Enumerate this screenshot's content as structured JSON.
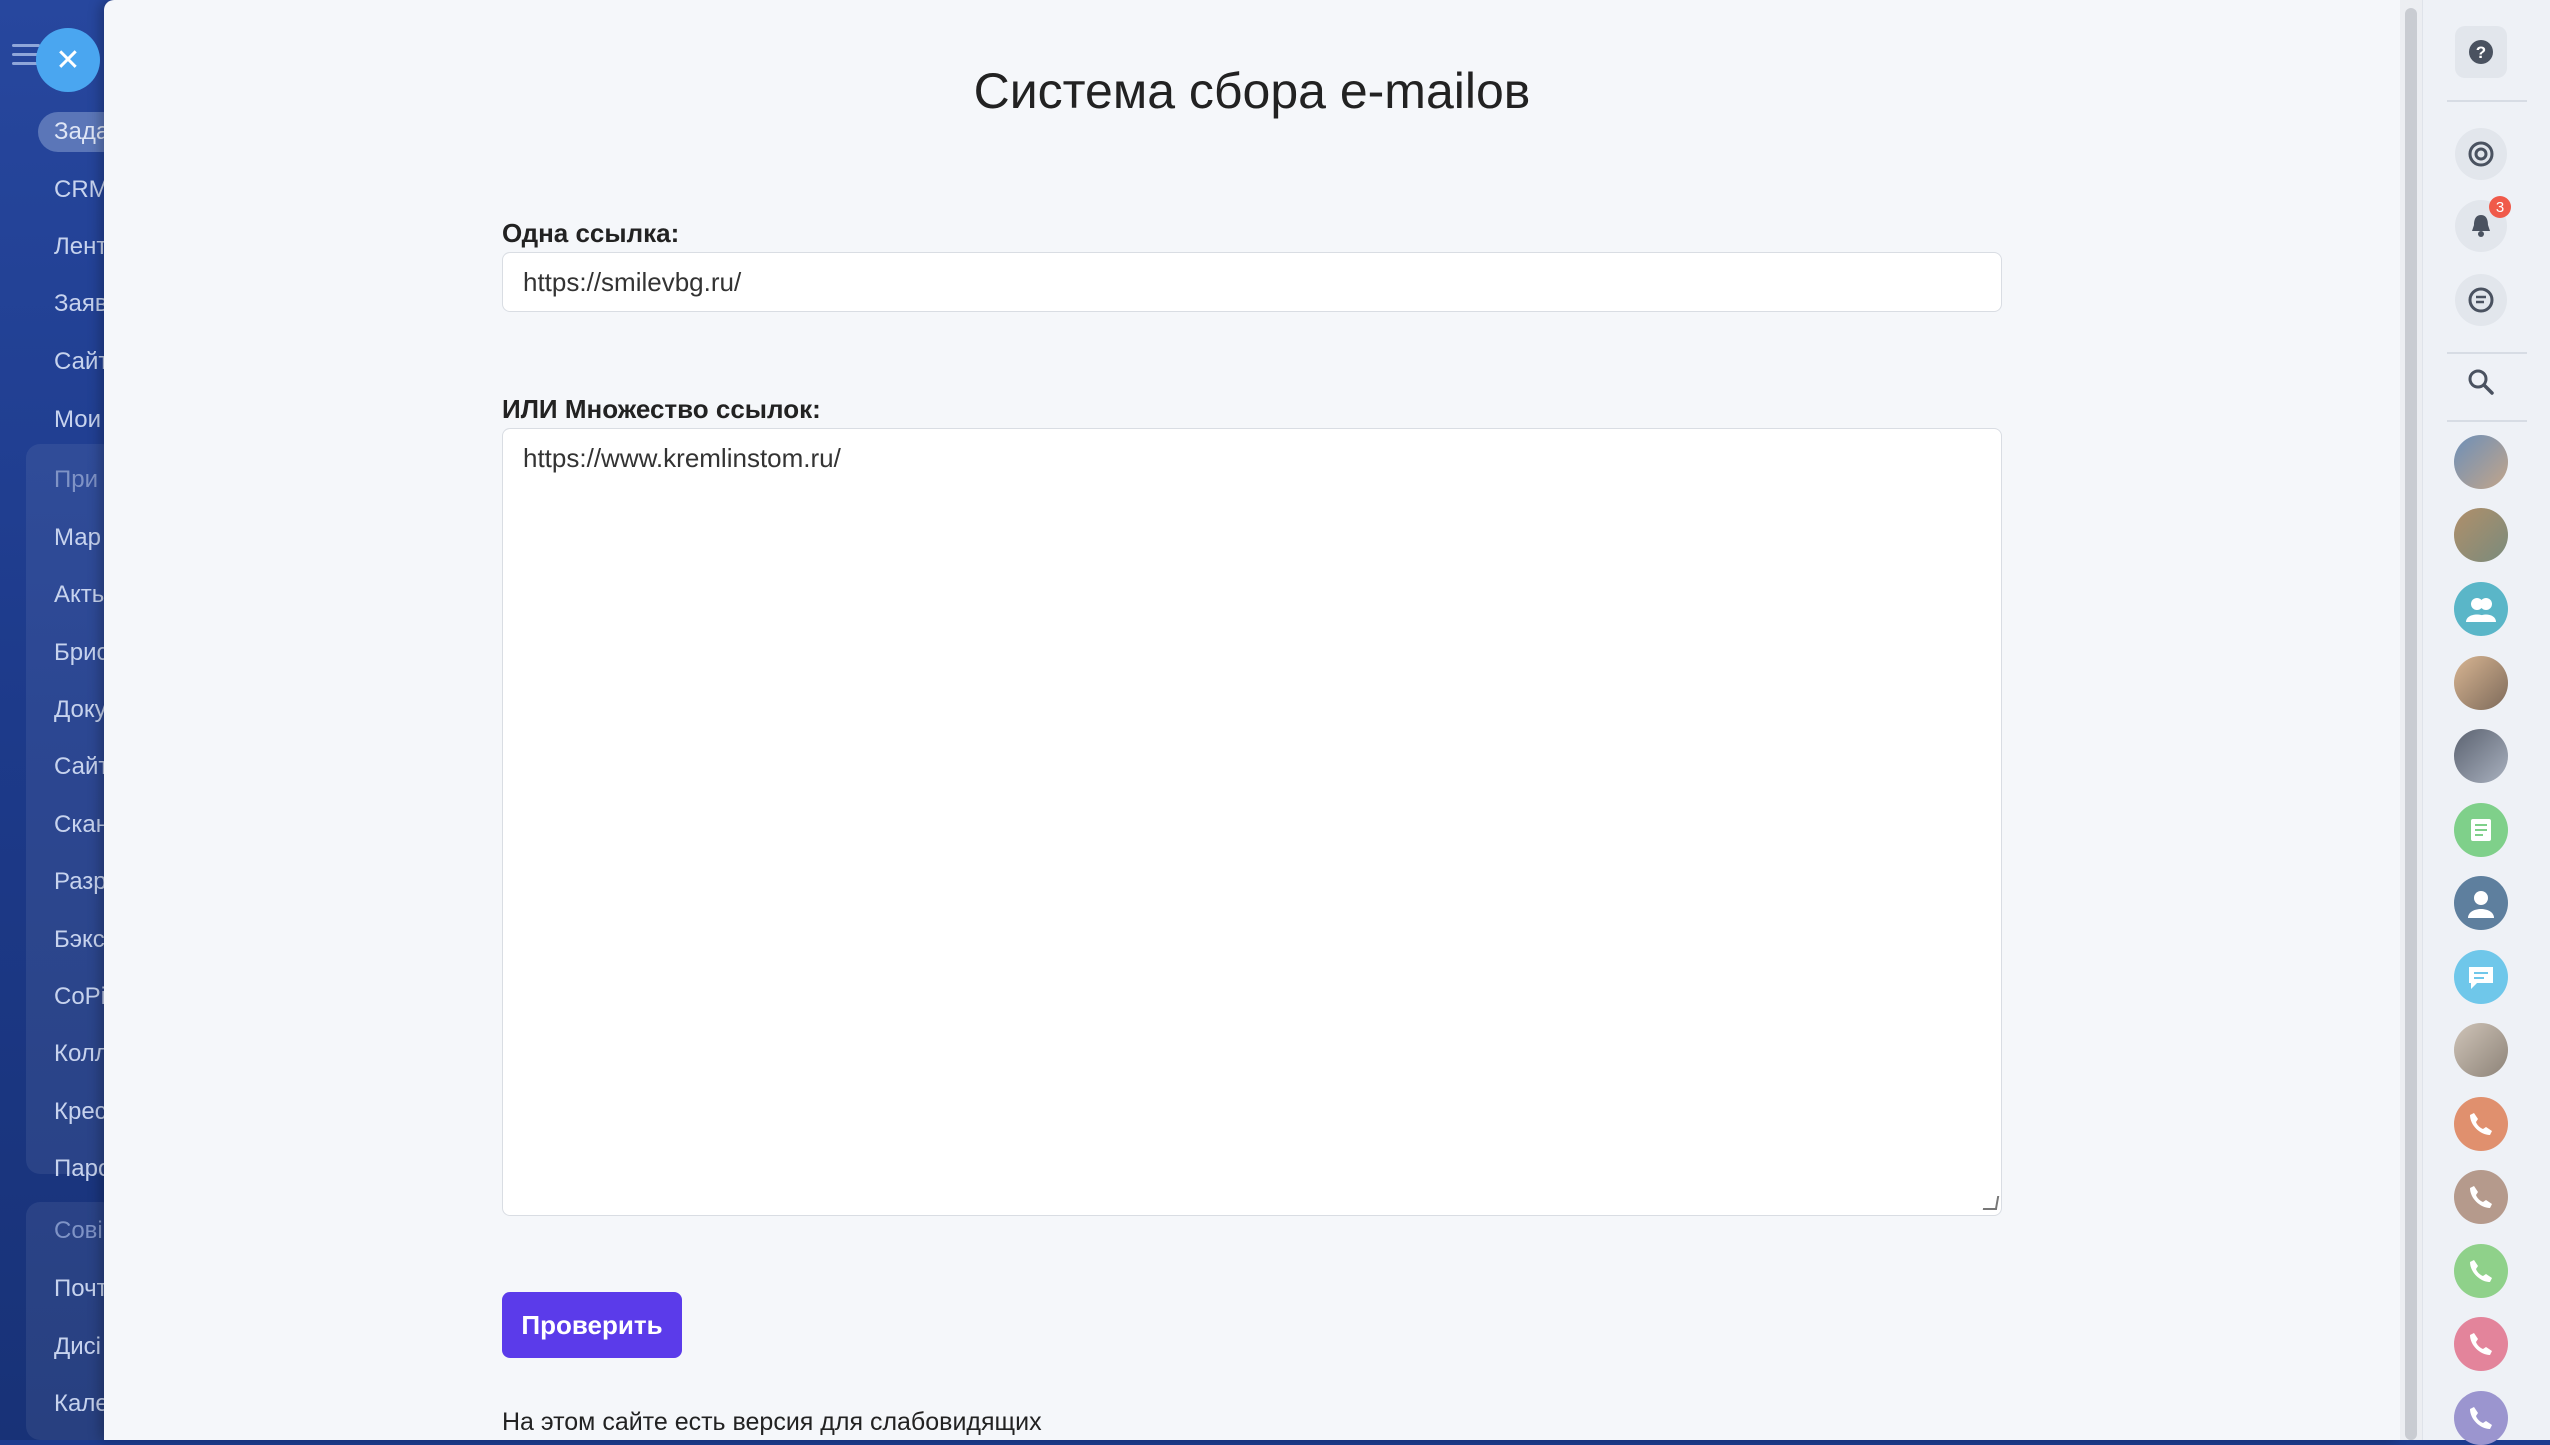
{
  "page": {
    "title": "Система сбора e-mailов",
    "single_link_label": "Одна ссылка:",
    "single_link_value": "https://smilevbg.ru/",
    "multi_link_label": "ИЛИ Множество ссылок:",
    "multi_link_value": "https://www.kremlinstom.ru/",
    "check_button": "Проверить",
    "accessibility_note": "На этом сайте есть версия для слабовидящих"
  },
  "left_sidebar": {
    "items": [
      {
        "label": "Зада",
        "active": true
      },
      {
        "label": "CRM"
      },
      {
        "label": "Лент"
      },
      {
        "label": "Заяв"
      },
      {
        "label": "Сайт"
      },
      {
        "label": "Мои"
      },
      {
        "label": "При",
        "group": true
      },
      {
        "label": "Мар"
      },
      {
        "label": "Акть"
      },
      {
        "label": "Брис"
      },
      {
        "label": "Доку"
      },
      {
        "label": "Сайт"
      },
      {
        "label": "Скан"
      },
      {
        "label": "Разр"
      },
      {
        "label": "Бэкс"
      },
      {
        "label": "СоРі"
      },
      {
        "label": "Колл"
      },
      {
        "label": "Крес"
      },
      {
        "label": "Пароі"
      },
      {
        "label": "Сові",
        "group": true
      },
      {
        "label": "Почт"
      },
      {
        "label": "Дисі"
      },
      {
        "label": "Кале"
      }
    ]
  },
  "right_sidebar": {
    "help_icon": "question-icon",
    "notifications_badge": "3",
    "colors": {
      "accent_button": "#5b3bea",
      "badge": "#f05a4a"
    }
  }
}
